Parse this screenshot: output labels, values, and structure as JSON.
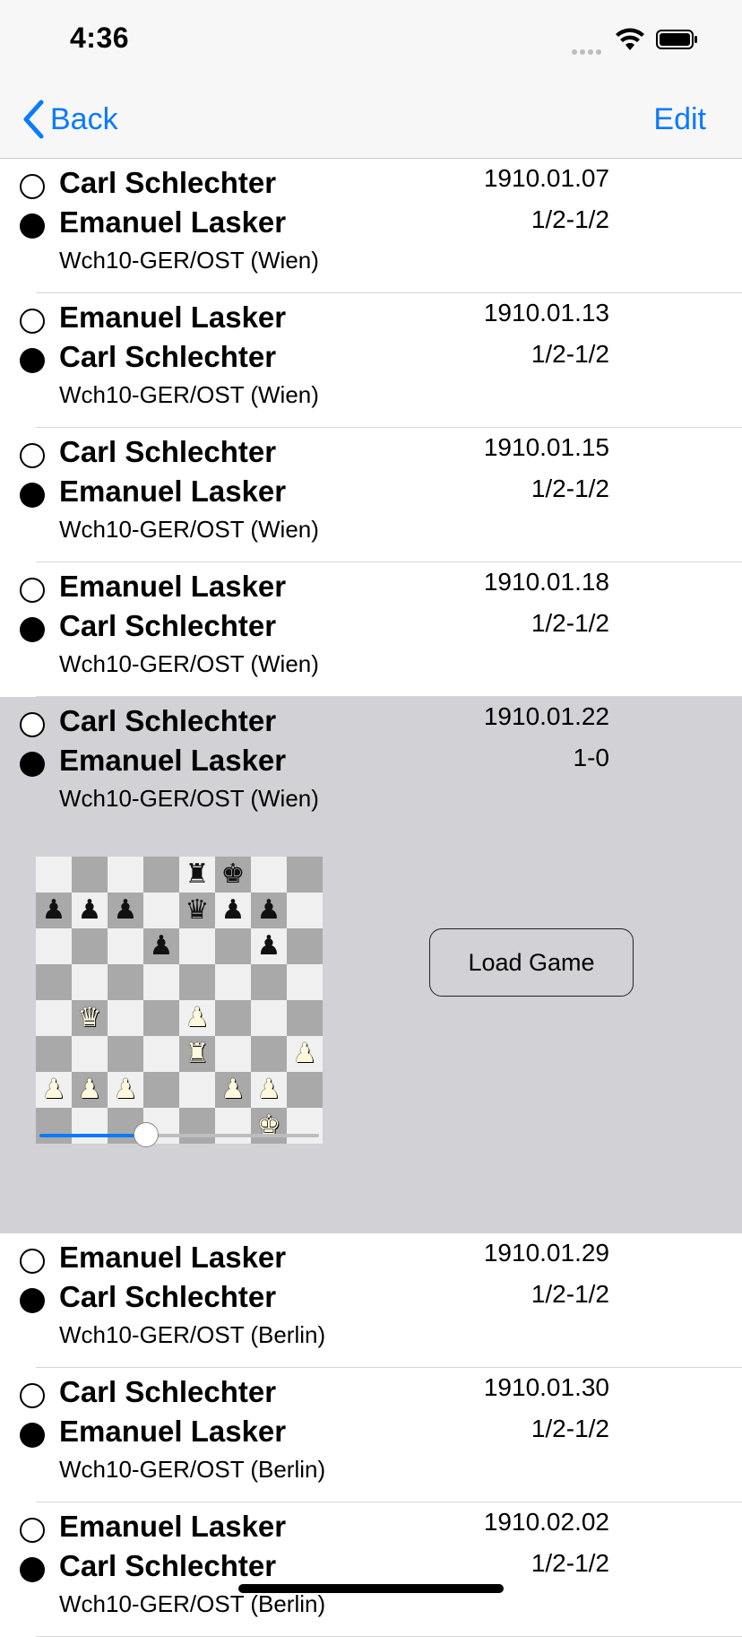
{
  "status": {
    "time": "4:36"
  },
  "nav": {
    "back_label": "Back",
    "edit_label": "Edit"
  },
  "games": [
    {
      "white": "Carl Schlechter",
      "black": "Emanuel Lasker",
      "date": "1910.01.07",
      "result": "1/2-1/2",
      "event": "Wch10-GER/OST (Wien)"
    },
    {
      "white": "Emanuel Lasker",
      "black": "Carl Schlechter",
      "date": "1910.01.13",
      "result": "1/2-1/2",
      "event": "Wch10-GER/OST (Wien)"
    },
    {
      "white": "Carl Schlechter",
      "black": "Emanuel Lasker",
      "date": "1910.01.15",
      "result": "1/2-1/2",
      "event": "Wch10-GER/OST (Wien)"
    },
    {
      "white": "Emanuel Lasker",
      "black": "Carl Schlechter",
      "date": "1910.01.18",
      "result": "1/2-1/2",
      "event": "Wch10-GER/OST (Wien)"
    },
    {
      "white": "Carl Schlechter",
      "black": "Emanuel Lasker",
      "date": "1910.01.22",
      "result": "1-0",
      "event": "Wch10-GER/OST (Wien)",
      "selected": true
    },
    {
      "white": "Emanuel Lasker",
      "black": "Carl Schlechter",
      "date": "1910.01.29",
      "result": "1/2-1/2",
      "event": "Wch10-GER/OST (Berlin)"
    },
    {
      "white": "Carl Schlechter",
      "black": "Emanuel Lasker",
      "date": "1910.01.30",
      "result": "1/2-1/2",
      "event": "Wch10-GER/OST (Berlin)"
    },
    {
      "white": "Emanuel Lasker",
      "black": "Carl Schlechter",
      "date": "1910.02.02",
      "result": "1/2-1/2",
      "event": "Wch10-GER/OST (Berlin)"
    }
  ],
  "preview": {
    "load_button_label": "Load Game",
    "move_slider_fraction": 0.38,
    "board": [
      "....rk..",
      "ppp.qpp.",
      "...p..p.",
      "........",
      ".Q..P...",
      "....R..P",
      "PPP..PP.",
      "......K."
    ],
    "piece_glyphs": {
      "K": "♔",
      "Q": "♕",
      "R": "♖",
      "B": "♗",
      "N": "♘",
      "P": "♙",
      "k": "♚",
      "q": "♛",
      "r": "♜",
      "b": "♝",
      "n": "♞",
      "p": "♟"
    },
    "colors": {
      "light_square": "#f0f0f0",
      "dark_square": "#a9a9a9",
      "accent": "#0a7aff",
      "selected_row": "#d1d1d6"
    }
  }
}
